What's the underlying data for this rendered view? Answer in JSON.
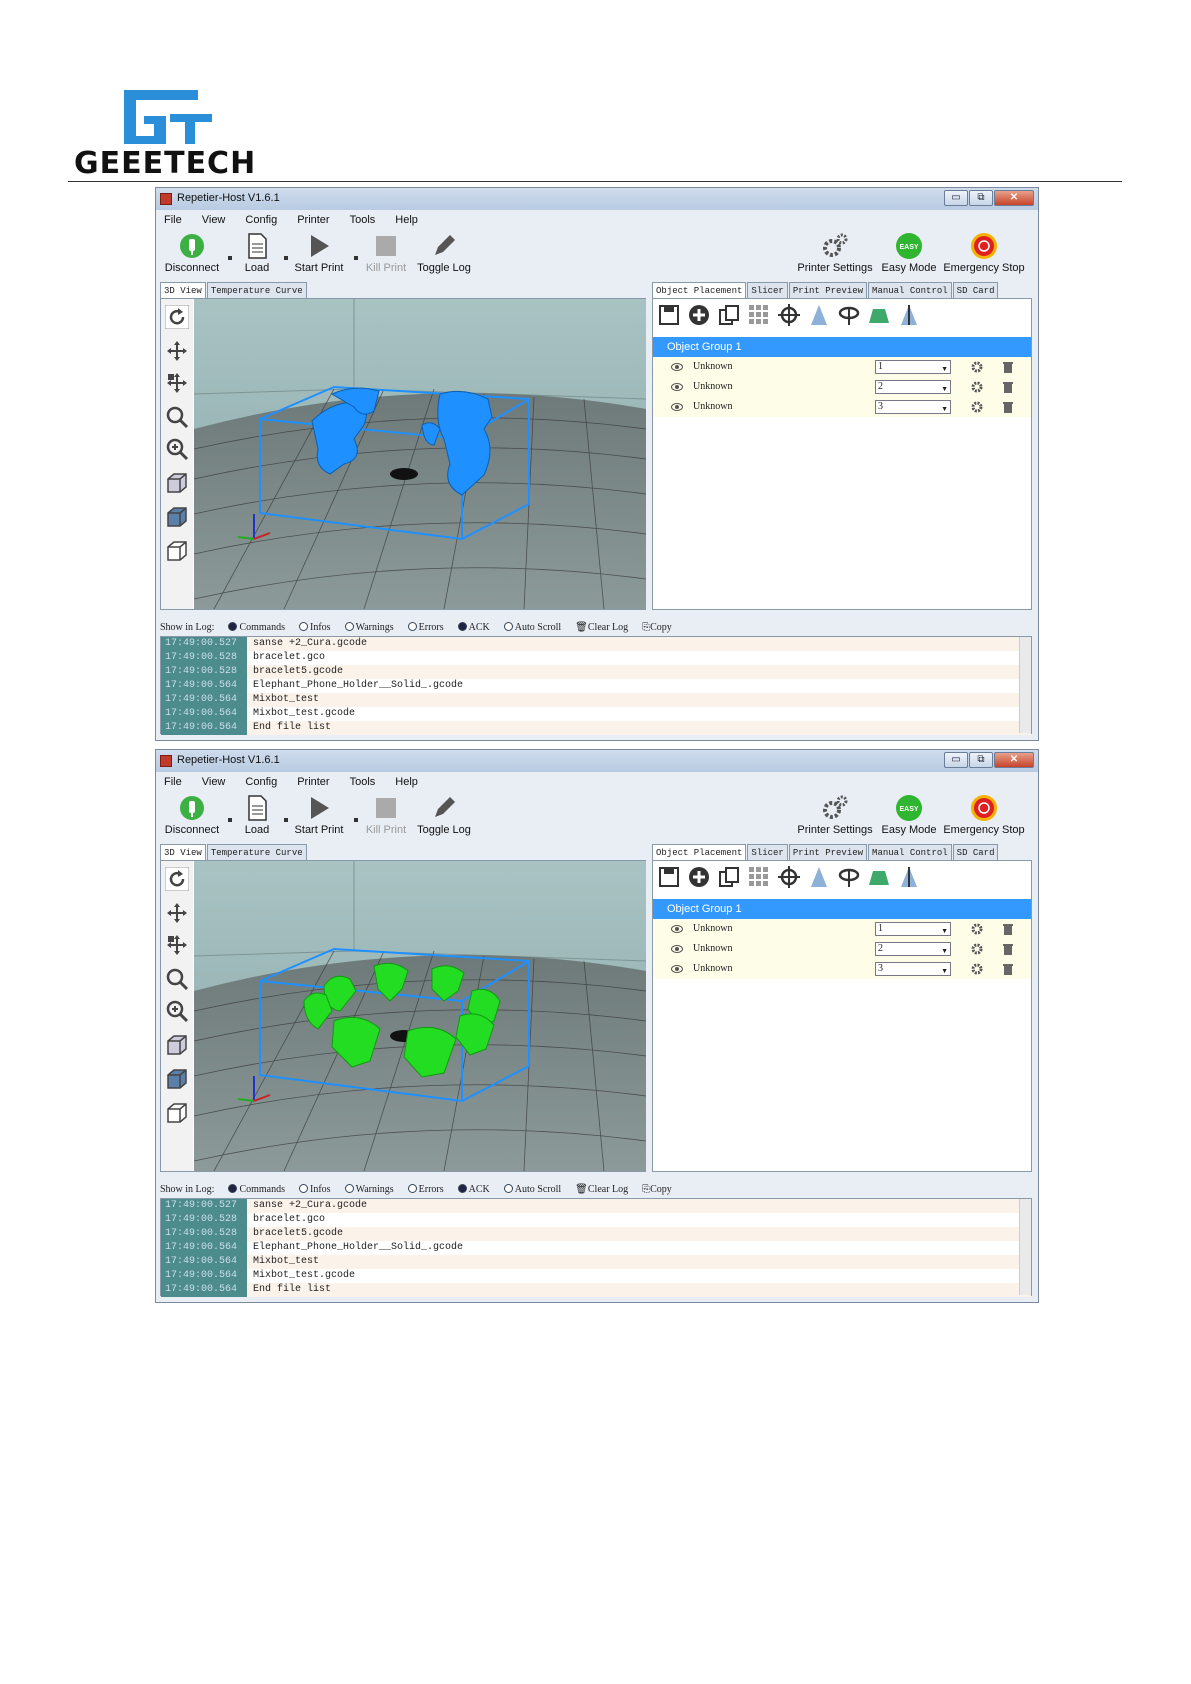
{
  "header": {
    "logo_text": "GEEETECH"
  },
  "windows": [
    {
      "title": "Repetier-Host V1.6.1",
      "window_controls": [
        "▭",
        "⧉",
        "✕"
      ],
      "menu": [
        "File",
        "View",
        "Config",
        "Printer",
        "Tools",
        "Help"
      ],
      "toolbar": {
        "disconnect": "Disconnect",
        "load": "Load",
        "start_print": "Start Print",
        "kill_print": "Kill Print",
        "toggle_log": "Toggle Log",
        "printer_settings": "Printer Settings",
        "easy_mode": "Easy Mode",
        "easy_badge": "EASY",
        "emergency_stop": "Emergency Stop"
      },
      "left_tabs": [
        "3D View",
        "Temperature Curve"
      ],
      "right_tabs": [
        "Object Placement",
        "Slicer",
        "Print Preview",
        "Manual Control",
        "SD Card"
      ],
      "object_group": "Object Group 1",
      "objects": [
        {
          "name": "Unknown",
          "copies": "1"
        },
        {
          "name": "Unknown",
          "copies": "2"
        },
        {
          "name": "Unknown",
          "copies": "3"
        }
      ],
      "model_color": "#1e90ff",
      "log_controls": {
        "show_in_log": "Show in Log:",
        "commands": "Commands",
        "infos": "Infos",
        "warnings": "Warnings",
        "errors": "Errors",
        "ack": "ACK",
        "auto_scroll": "Auto Scroll",
        "clear_log": "Clear Log",
        "copy": "Copy"
      },
      "log": [
        {
          "time": "17:49:00.527",
          "msg": "sanse +2_Cura.gcode"
        },
        {
          "time": "17:49:00.528",
          "msg": "bracelet.gco"
        },
        {
          "time": "17:49:00.528",
          "msg": "bracelet5.gcode"
        },
        {
          "time": "17:49:00.564",
          "msg": "Elephant_Phone_Holder__Solid_.gcode"
        },
        {
          "time": "17:49:00.564",
          "msg": "Mixbot_test"
        },
        {
          "time": "17:49:00.564",
          "msg": "Mixbot_test.gcode"
        },
        {
          "time": "17:49:00.564",
          "msg": "End file list"
        }
      ]
    },
    {
      "title": "Repetier-Host V1.6.1",
      "window_controls": [
        "▭",
        "⧉",
        "✕"
      ],
      "menu": [
        "File",
        "View",
        "Config",
        "Printer",
        "Tools",
        "Help"
      ],
      "toolbar": {
        "disconnect": "Disconnect",
        "load": "Load",
        "start_print": "Start Print",
        "kill_print": "Kill Print",
        "toggle_log": "Toggle Log",
        "printer_settings": "Printer Settings",
        "easy_mode": "Easy Mode",
        "easy_badge": "EASY",
        "emergency_stop": "Emergency Stop"
      },
      "left_tabs": [
        "3D View",
        "Temperature Curve"
      ],
      "right_tabs": [
        "Object Placement",
        "Slicer",
        "Print Preview",
        "Manual Control",
        "SD Card"
      ],
      "object_group": "Object Group 1",
      "objects": [
        {
          "name": "Unknown",
          "copies": "1"
        },
        {
          "name": "Unknown",
          "copies": "2"
        },
        {
          "name": "Unknown",
          "copies": "3"
        }
      ],
      "model_color": "#22dd22",
      "log_controls": {
        "show_in_log": "Show in Log:",
        "commands": "Commands",
        "infos": "Infos",
        "warnings": "Warnings",
        "errors": "Errors",
        "ack": "ACK",
        "auto_scroll": "Auto Scroll",
        "clear_log": "Clear Log",
        "copy": "Copy"
      },
      "log": [
        {
          "time": "17:49:00.527",
          "msg": "sanse +2_Cura.gcode"
        },
        {
          "time": "17:49:00.528",
          "msg": "bracelet.gco"
        },
        {
          "time": "17:49:00.528",
          "msg": "bracelet5.gcode"
        },
        {
          "time": "17:49:00.564",
          "msg": "Elephant_Phone_Holder__Solid_.gcode"
        },
        {
          "time": "17:49:00.564",
          "msg": "Mixbot_test"
        },
        {
          "time": "17:49:00.564",
          "msg": "Mixbot_test.gcode"
        },
        {
          "time": "17:49:00.564",
          "msg": "End file list"
        }
      ]
    }
  ]
}
